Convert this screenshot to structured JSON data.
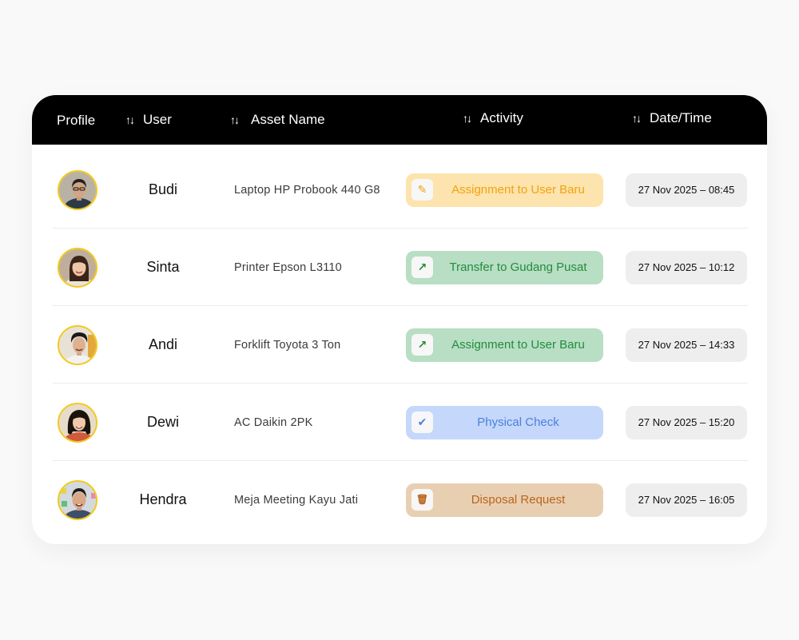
{
  "header": {
    "profile": "Profile",
    "user": "User",
    "asset_name": "Asset Name",
    "activity": "Activity",
    "datetime": "Date/Time",
    "sort_icon": "↑↓"
  },
  "rows": [
    {
      "user": "Budi",
      "asset": "Laptop HP Probook 440 G8",
      "activity": "Assignment to User Baru",
      "activity_icon": "pencil-icon",
      "icon_glyph": "✎",
      "bg": "#fde3ad",
      "fg": "#f1a30f",
      "datetime": "27 Nov 2025 – 08:45"
    },
    {
      "user": "Sinta",
      "asset": "Printer Epson L3110",
      "activity": "Transfer to Gudang Pusat",
      "activity_icon": "arrow-up-right-icon",
      "icon_glyph": "↗",
      "bg": "#b8dec4",
      "fg": "#228c3c",
      "datetime": "27 Nov 2025 – 10:12"
    },
    {
      "user": "Andi",
      "asset": "Forklift Toyota 3 Ton",
      "activity": "Assignment to User Baru",
      "activity_icon": "arrow-up-right-icon",
      "icon_glyph": "↗",
      "bg": "#b8dec4",
      "fg": "#228c3c",
      "datetime": "27 Nov 2025 – 14:33"
    },
    {
      "user": "Dewi",
      "asset": "AC Daikin 2PK",
      "activity": "Physical Check",
      "activity_icon": "checkmark-icon",
      "icon_glyph": "✔",
      "bg": "#c5d7fa",
      "fg": "#4b80de",
      "datetime": "27 Nov 2025 – 15:20"
    },
    {
      "user": "Hendra",
      "asset": "Meja Meeting Kayu Jati",
      "activity": "Disposal Request",
      "activity_icon": "trash-icon",
      "icon_glyph": "🗑",
      "bg": "#e9cfb2",
      "fg": "#b9651b",
      "datetime": "27 Nov 2025 – 16:05"
    }
  ]
}
